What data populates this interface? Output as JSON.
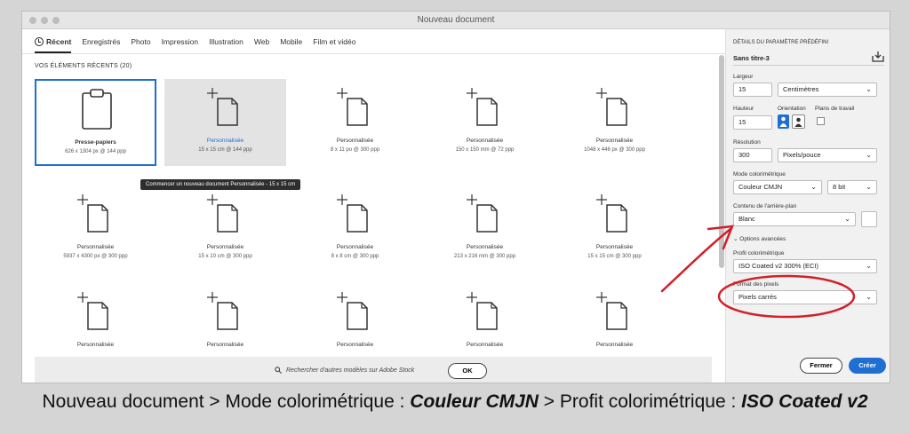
{
  "window": {
    "title": "Nouveau document"
  },
  "tabs": [
    {
      "label": "Récent",
      "icon": "clock-icon"
    },
    {
      "label": "Enregistrés"
    },
    {
      "label": "Photo"
    },
    {
      "label": "Impression"
    },
    {
      "label": "Illustration"
    },
    {
      "label": "Web"
    },
    {
      "label": "Mobile"
    },
    {
      "label": "Film et vidéo"
    }
  ],
  "recent": {
    "title": "VOS ÉLÉMENTS RÉCENTS (20)",
    "items": [
      {
        "name": "Presse-papiers",
        "size": "626 x 1304 px @ 144 ppp",
        "icon": "clipboard-icon"
      },
      {
        "name": "Personnalisée",
        "size": "15 x 15 cm @ 144 ppp",
        "icon": "document-icon"
      },
      {
        "name": "Personnalisée",
        "size": "8 x 11 po @ 300 ppp",
        "icon": "document-icon"
      },
      {
        "name": "Personnalisée",
        "size": "150 x 150 mm @ 72 ppp",
        "icon": "document-icon"
      },
      {
        "name": "Personnalisée",
        "size": "1048 x 446 px @ 300 ppp",
        "icon": "document-icon"
      },
      {
        "name": "Personnalisée",
        "size": "5937 x 4300 px @ 300 ppp",
        "icon": "document-icon"
      },
      {
        "name": "Personnalisée",
        "size": "15 x 10 cm @ 300 ppp",
        "icon": "document-icon"
      },
      {
        "name": "Personnalisée",
        "size": "8 x 8 cm @ 300 ppp",
        "icon": "document-icon"
      },
      {
        "name": "Personnalisée",
        "size": "213 x 216 mm @ 300 ppp",
        "icon": "document-icon"
      },
      {
        "name": "Personnalisée",
        "size": "15 x 15 cm @ 300 ppp",
        "icon": "document-icon"
      },
      {
        "name": "Personnalisée",
        "size": "",
        "icon": "document-icon"
      },
      {
        "name": "Personnalisée",
        "size": "",
        "icon": "document-icon"
      },
      {
        "name": "Personnalisée",
        "size": "",
        "icon": "document-icon"
      },
      {
        "name": "Personnalisée",
        "size": "",
        "icon": "document-icon"
      },
      {
        "name": "Personnalisée",
        "size": "",
        "icon": "document-icon"
      }
    ],
    "tooltip": "Commencer un nouveau document Personnalisée - 15 x 15 cm"
  },
  "search": {
    "label": "Rechercher d'autres modèles sur Adobe Stock",
    "ok": "OK",
    "icon": "search-icon"
  },
  "panel": {
    "header": "DÉTAILS DU PARAMÈTRE PRÉDÉFINI",
    "doc_name": "Sans titre-3",
    "save_icon": "save-preset-icon",
    "width_label": "Largeur",
    "width": "15",
    "unit": "Centimètres",
    "height_label": "Hauteur",
    "height": "15",
    "orientation_label": "Orientation",
    "artboards_label": "Plans de travail",
    "resolution_label": "Résolution",
    "resolution": "300",
    "resolution_unit": "Pixels/pouce",
    "color_mode_label": "Mode colorimétrique",
    "color_mode": "Couleur CMJN",
    "bit_depth": "8 bit",
    "background_label": "Contenu de l'arrière-plan",
    "background": "Blanc",
    "advanced_label": "Options avancées",
    "profile_label": "Profil colorimétrique",
    "profile": "ISO Coated v2 300% (ECI)",
    "pixel_label": "Format des pixels",
    "pixel": "Pixels carrés",
    "close": "Fermer",
    "create": "Créer"
  },
  "caption": {
    "part1": "Nouveau document > Mode colorimétrique : ",
    "emph1": "Couleur CMJN",
    "part2": " > Profit colorimétrique : ",
    "emph2": "ISO Coated v2"
  },
  "colors": {
    "accent": "#1f6fd2",
    "annotation": "#d0202a"
  }
}
